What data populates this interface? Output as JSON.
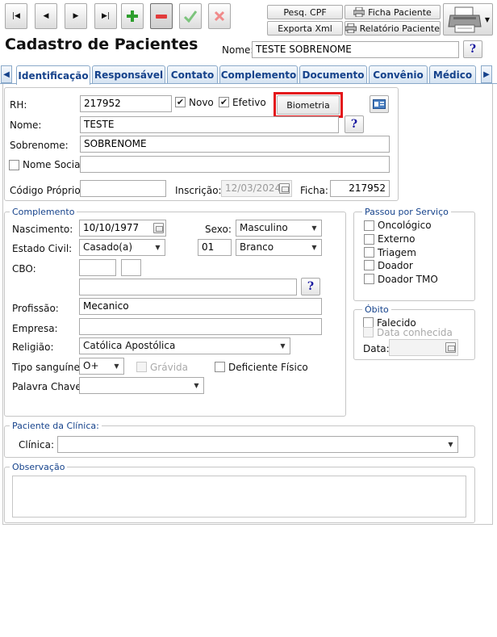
{
  "toolbar": {
    "nav": [
      {
        "name": "first-record-button",
        "glyph": "|◀"
      },
      {
        "name": "prev-record-button",
        "glyph": "◀"
      },
      {
        "name": "next-record-button",
        "glyph": "▶"
      },
      {
        "name": "last-record-button",
        "glyph": "▶|"
      }
    ],
    "pesq_cpf": "Pesq. CPF",
    "exporta_xml": "Exporta Xml",
    "ficha_paciente": "Ficha Paciente",
    "relatorio_paciente": "Relatório Paciente",
    "colors": {
      "add": "#2e9e2e",
      "remove": "#e23b3b",
      "confirm": "#7cc47c",
      "cancel": "#f08a8a"
    }
  },
  "header": {
    "title": "Cadastro de Pacientes",
    "nome_label": "Nome:",
    "nome_value": "TESTE SOBRENOME",
    "help": "?"
  },
  "tabs": [
    {
      "label": "Identificação",
      "active": true
    },
    {
      "label": "Responsável"
    },
    {
      "label": "Contato"
    },
    {
      "label": "Complemento"
    },
    {
      "label": "Documento"
    },
    {
      "label": "Convênio"
    },
    {
      "label": "Médico"
    }
  ],
  "ident": {
    "rh_label": "RH:",
    "rh_value": "217952",
    "novo_label": "Novo",
    "efetivo_label": "Efetivo",
    "biometria": "Biometria",
    "nome_label": "Nome:",
    "nome_value": "TESTE",
    "sobrenome_label": "Sobrenome:",
    "sobrenome_value": "SOBRENOME",
    "nome_social_label": "Nome Social:",
    "nome_social_value": "",
    "codigo_label": "Código Próprio:",
    "codigo_value": "",
    "inscricao_label": "Inscrição:",
    "inscricao_value": "12/03/2024",
    "ficha_label": "Ficha:",
    "ficha_value": "217952"
  },
  "complemento": {
    "legend": "Complemento",
    "nascimento_label": "Nascimento:",
    "nascimento_value": "10/10/1977",
    "sexo_label": "Sexo:",
    "sexo_value": "Masculino",
    "estado_civil_label": "Estado Civil:",
    "estado_civil_value": "Casado(a)",
    "raca_code": "01",
    "raca_value": "Branco",
    "cbo_label": "CBO:",
    "profissao_label": "Profissão:",
    "profissao_value": "Mecanico",
    "empresa_label": "Empresa:",
    "empresa_value": "",
    "religiao_label": "Religião:",
    "religiao_value": "Católica Apostólica",
    "tipo_sanguineo_label": "Tipo sanguíneo:",
    "tipo_sanguineo_value": "O+",
    "gravida_label": "Grávida",
    "deficiente_label": "Deficiente Físico",
    "palavra_chave_label": "Palavra Chave:",
    "palavra_chave_value": ""
  },
  "servico": {
    "legend": "Passou por Serviço",
    "items": [
      "Oncológico",
      "Externo",
      "Triagem",
      "Doador",
      "Doador TMO"
    ]
  },
  "obito": {
    "legend": "Óbito",
    "falecido": "Falecido",
    "data_conhecida": "Data conhecida",
    "data_label": "Data:"
  },
  "clinica": {
    "legend": "Paciente da Clínica:",
    "label": "Clínica:",
    "value": ""
  },
  "observacao": {
    "legend": "Observação"
  },
  "highlight_color": "#e3151a"
}
